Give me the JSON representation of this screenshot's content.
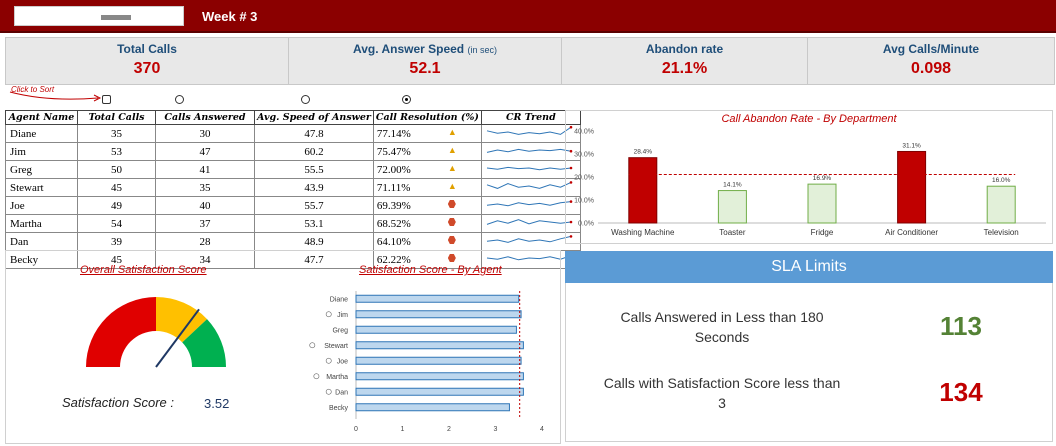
{
  "header": {
    "week_label": "Week # 3"
  },
  "kpis": [
    {
      "title": "Total Calls",
      "sub": "",
      "value": "370"
    },
    {
      "title": "Avg. Answer Speed",
      "sub": "(in sec)",
      "value": "52.1"
    },
    {
      "title": "Abandon rate",
      "sub": "",
      "value": "21.1%"
    },
    {
      "title": "Avg Calls/Minute",
      "sub": "",
      "value": "0.098"
    }
  ],
  "sort": {
    "note": "Click to Sort",
    "selected": 4
  },
  "agent_table": {
    "columns": [
      "Agent Name",
      "Total Calls",
      "Calls Answered",
      "Avg. Speed of Answer",
      "Call Resolution (%)",
      "CR Trend"
    ],
    "rows": [
      {
        "name": "Diane",
        "total": "35",
        "answered": "30",
        "speed": "47.8",
        "cr": "77.14%",
        "symbol": "triangle"
      },
      {
        "name": "Jim",
        "total": "53",
        "answered": "47",
        "speed": "60.2",
        "cr": "75.47%",
        "symbol": "triangle"
      },
      {
        "name": "Greg",
        "total": "50",
        "answered": "41",
        "speed": "55.5",
        "cr": "72.00%",
        "symbol": "triangle"
      },
      {
        "name": "Stewart",
        "total": "45",
        "answered": "35",
        "speed": "43.9",
        "cr": "71.11%",
        "symbol": "triangle"
      },
      {
        "name": "Joe",
        "total": "49",
        "answered": "40",
        "speed": "55.7",
        "cr": "69.39%",
        "symbol": "hexagon"
      },
      {
        "name": "Martha",
        "total": "54",
        "answered": "37",
        "speed": "53.1",
        "cr": "68.52%",
        "symbol": "hexagon"
      },
      {
        "name": "Dan",
        "total": "39",
        "answered": "28",
        "speed": "48.9",
        "cr": "64.10%",
        "symbol": "hexagon"
      },
      {
        "name": "Becky",
        "total": "45",
        "answered": "34",
        "speed": "47.7",
        "cr": "62.22%",
        "symbol": "hexagon"
      }
    ],
    "sparklines": [
      [
        0.6,
        0.4,
        0.5,
        0.3,
        0.45,
        0.35,
        0.5,
        0.3,
        0.9
      ],
      [
        0.3,
        0.5,
        0.35,
        0.55,
        0.4,
        0.5,
        0.45,
        0.55,
        0.4
      ],
      [
        0.5,
        0.4,
        0.55,
        0.45,
        0.5,
        0.35,
        0.5,
        0.4,
        0.5
      ],
      [
        0.6,
        0.3,
        0.7,
        0.4,
        0.5,
        0.3,
        0.6,
        0.4,
        0.8
      ],
      [
        0.4,
        0.5,
        0.35,
        0.6,
        0.45,
        0.55,
        0.4,
        0.6,
        0.7
      ],
      [
        0.3,
        0.6,
        0.4,
        0.7,
        0.35,
        0.6,
        0.5,
        0.4,
        0.5
      ],
      [
        0.4,
        0.5,
        0.3,
        0.6,
        0.4,
        0.5,
        0.35,
        0.6,
        0.8
      ],
      [
        0.5,
        0.4,
        0.6,
        0.35,
        0.5,
        0.45,
        0.6,
        0.4,
        0.7
      ]
    ]
  },
  "colors": {
    "header": "#8b0000",
    "kpi_value": "#c00000",
    "kpi_title": "#1f4e79",
    "bar_high": "#c00000",
    "bar_low": "#e2f0d9",
    "sla_green": "#548235",
    "sla_red": "#c00000",
    "gauge_red": "#e00000",
    "gauge_yellow": "#ffc000",
    "gauge_green": "#00b050"
  },
  "chart_data": [
    {
      "type": "bar",
      "title": "Call Abandon Rate - By Department",
      "categories": [
        "Washing Machine",
        "Toaster",
        "Fridge",
        "Air Conditioner",
        "Television"
      ],
      "values": [
        28.4,
        14.1,
        16.9,
        31.1,
        16.0
      ],
      "value_labels": [
        "28.4%",
        "14.1%",
        "16.9%",
        "31.1%",
        "16.0%"
      ],
      "ylim": [
        0,
        40
      ],
      "yticks": [
        "0.0%",
        "10.0%",
        "20.0%",
        "30.0%",
        "40.0%"
      ],
      "reference_line": 21.1,
      "grid": false
    },
    {
      "type": "bar",
      "orientation": "horizontal",
      "title": "Satisfaction Score - By Agent",
      "categories": [
        "Diane",
        "Jim",
        "Greg",
        "Stewart",
        "Joe",
        "Martha",
        "Dan",
        "Becky"
      ],
      "smiley": [
        false,
        true,
        false,
        true,
        true,
        true,
        true,
        false
      ],
      "values": [
        3.5,
        3.55,
        3.45,
        3.6,
        3.55,
        3.6,
        3.6,
        3.3
      ],
      "xlim": [
        0,
        4
      ],
      "xticks": [
        "0",
        "1",
        "2",
        "3",
        "4"
      ],
      "reference_line": 3.52
    }
  ],
  "gauge": {
    "title": "Overall Satisfaction Score",
    "label": "Satisfaction Score :",
    "value": "3.52",
    "score": 3.52,
    "max": 5
  },
  "sla": {
    "title": "SLA Limits",
    "rows": [
      {
        "text": "Calls Answered in Less than 180 Seconds",
        "value": "113",
        "color": "#548235"
      },
      {
        "text": "Calls with Satisfaction Score less than 3",
        "value": "134",
        "color": "#c00000"
      }
    ]
  }
}
